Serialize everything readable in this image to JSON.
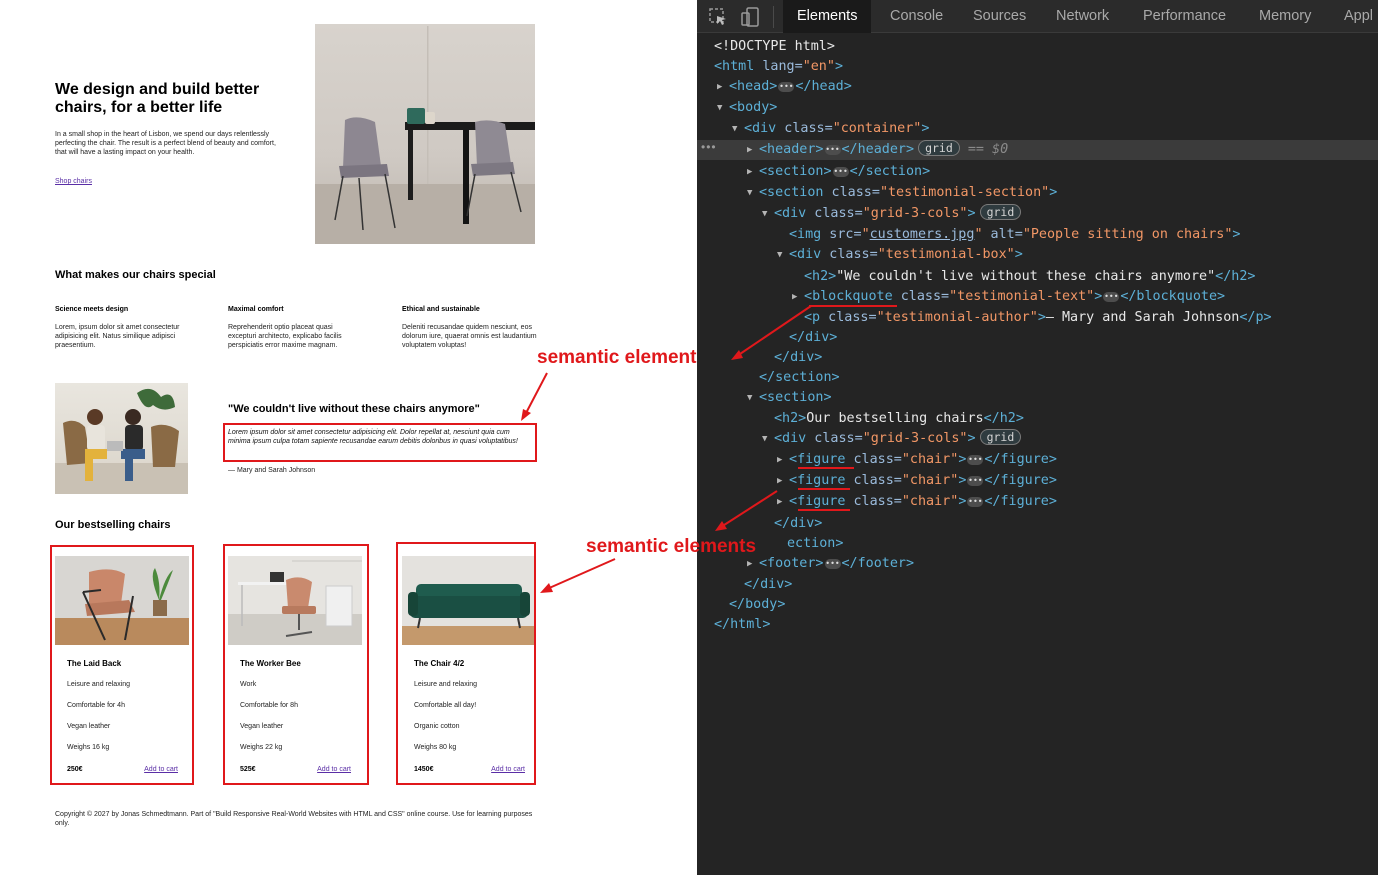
{
  "hero": {
    "title": "We design and build better chairs, for a better life",
    "text": "In a small shop in the heart of Lisbon, we spend our days relentlessly perfecting the chair. The result is a perfect blend of beauty and comfort, that will have a lasting impact on your health.",
    "link": "Shop chairs"
  },
  "features": {
    "title": "What makes our chairs special",
    "items": [
      {
        "title": "Science meets design",
        "text": "Lorem, ipsum dolor sit amet consectetur adipisicing elit. Natus similique adipisci praesentium."
      },
      {
        "title": "Maximal comfort",
        "text": "Reprehenderit optio placeat quasi excepturi architecto, explicabo facilis perspiciatis error maxime magnam."
      },
      {
        "title": "Ethical and sustainable",
        "text": "Deleniti recusandae quidem nesciunt, eos dolorum iure, quaerat omnis est laudantium voluptatem voluptas!"
      }
    ]
  },
  "testimonial": {
    "title": "\"We couldn't live without these chairs anymore\"",
    "quote": "Lorem ipsum dolor sit amet consectetur adipisicing elit. Dolor repellat at, nesciunt quia cum minima ipsum culpa totam sapiente recusandae earum debitis doloribus in quasi voluptatibus!",
    "author": "— Mary and Sarah Johnson"
  },
  "bestsellers": {
    "title": "Our bestselling chairs",
    "cart_label": "Add to cart",
    "chairs": [
      {
        "name": "The Laid Back",
        "attrs": [
          "Leisure and relaxing",
          "Comfortable for 4h",
          "Vegan leather",
          "Weighs 16 kg"
        ],
        "price": "250€"
      },
      {
        "name": "The Worker Bee",
        "attrs": [
          "Work",
          "Comfortable for 8h",
          "Vegan leather",
          "Weighs 22 kg"
        ],
        "price": "525€"
      },
      {
        "name": "The Chair 4/2",
        "attrs": [
          "Leisure and relaxing",
          "Comfortable all day!",
          "Organic cotton",
          "Weighs 80 kg"
        ],
        "price": "1450€"
      }
    ]
  },
  "footer": {
    "text": "Copyright © 2027 by Jonas Schmedtmann. Part of \"Build Responsive Real-World Websites with HTML and CSS\" online course. Use for learning purposes only."
  },
  "annotations": {
    "semantic_element": "semantic element",
    "semantic_elements": "semantic elements",
    "color": "#e0181b"
  },
  "devtools": {
    "tabs": [
      "Elements",
      "Console",
      "Sources",
      "Network",
      "Performance",
      "Memory",
      "Appl"
    ],
    "active_tab": "Elements",
    "grid_badge": "grid",
    "selected_marker": "== $0",
    "code": {
      "doctype": "<!DOCTYPE html>",
      "html_open": "<html",
      "lang_attr": " lang=",
      "lang_val": "\"en\"",
      "close_gt": ">",
      "head_open": "<head>",
      "head_close": "</head>",
      "body_open": "<body>",
      "div_open": "<div",
      "class_attr": " class=",
      "container_val": "\"container\"",
      "header_open": "<header>",
      "header_close": "</header>",
      "section_open": "<section>",
      "section_open_bare": "<section",
      "section_close": "</section>",
      "testimonial_section_val": "\"testimonial-section\"",
      "grid3_val": "\"grid-3-cols\"",
      "img_open": "<img",
      "src_attr": " src=",
      "quote": "\"",
      "src_val": "customers.jpg",
      "alt_attr": " alt=",
      "alt_val": "\"People sitting on chairs\"",
      "testimonial_box_val": "\"testimonial-box\"",
      "h2_open": "<h2>",
      "h2_close": "</h2>",
      "h2_text": "\"We couldn't live without these chairs anymore\"",
      "blockquote_open_lt": "<",
      "blockquote_name": "blockquote",
      "testimonial_text_val": "\"testimonial-text\"",
      "blockquote_close": "</blockquote>",
      "p_open": "<p",
      "testimonial_author_val": "\"testimonial-author\"",
      "p_text": "— Mary and Sarah Johnson",
      "p_close": "</p>",
      "div_close": "</div>",
      "h2_bestselling": "Our bestselling chairs",
      "figure_lt": "<",
      "figure_name": "figure",
      "chair_val": "\"chair\"",
      "figure_close": "</figure>",
      "footer_open": "<footer>",
      "footer_close": "</footer>",
      "body_close": "</body>",
      "html_close": "</html>",
      "section_close_partial": "ection>"
    }
  }
}
